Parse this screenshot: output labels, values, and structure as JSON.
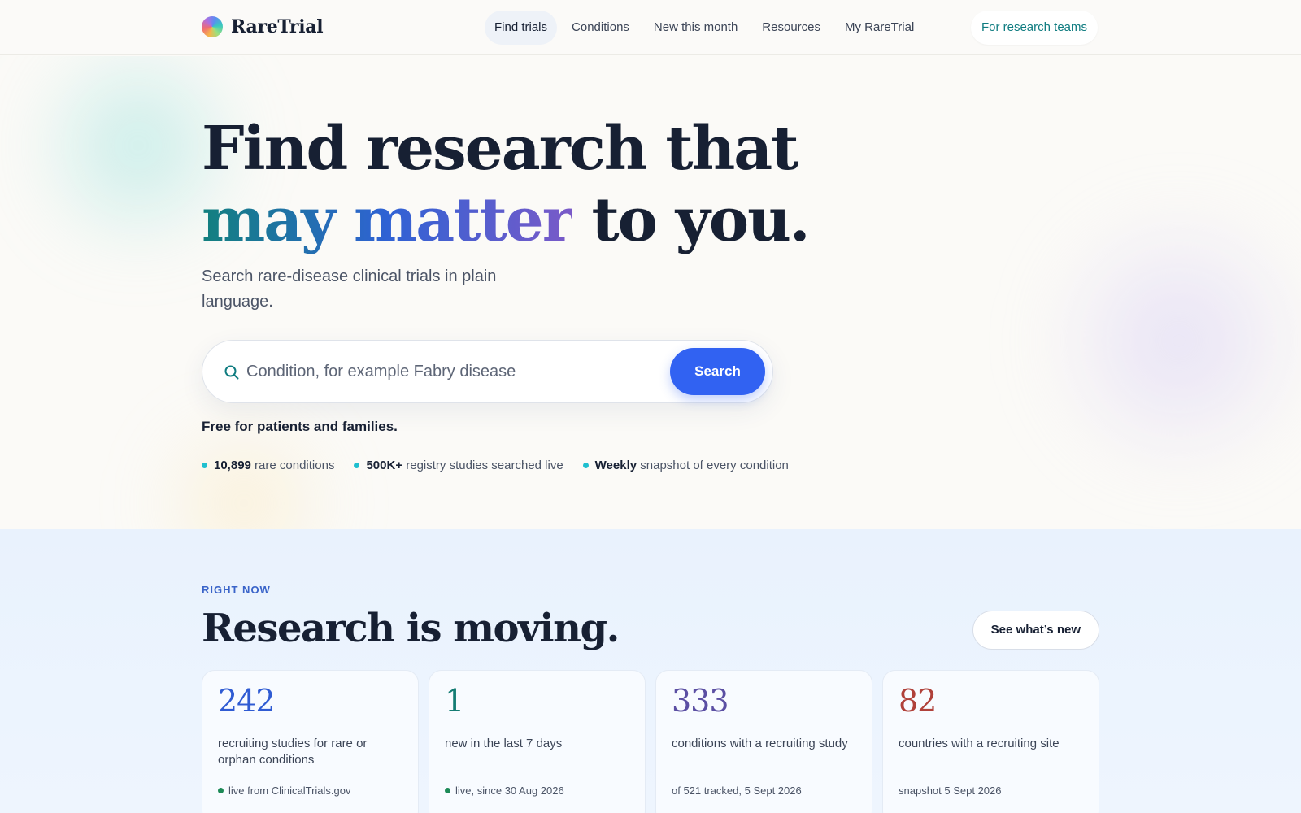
{
  "brand": {
    "name": "RareTrial",
    "logo_icon": "raretrial-logo-icon"
  },
  "nav": {
    "links": [
      {
        "label": "Find trials",
        "active": true
      },
      {
        "label": "Conditions",
        "active": false
      },
      {
        "label": "New this month",
        "active": false
      },
      {
        "label": "Resources",
        "active": false
      },
      {
        "label": "My RareTrial",
        "active": false
      }
    ],
    "cta_label": "For research teams"
  },
  "hero": {
    "headline_line1": "Find research that",
    "headline_highlight": "may matter",
    "headline_rest": " to you.",
    "subtitle": "Search rare-disease clinical trials in plain language.",
    "search": {
      "icon": "search-icon",
      "placeholder": "Condition, for example Fabry disease",
      "value": "",
      "button_label": "Search"
    },
    "free_note": "Free for patients and families.",
    "stats": [
      {
        "strong": "10,899",
        "text": " rare conditions"
      },
      {
        "strong": "500K+",
        "text": " registry studies searched live"
      },
      {
        "strong": "Weekly",
        "text": " snapshot of every condition"
      }
    ]
  },
  "right_now": {
    "eyebrow": "RIGHT NOW",
    "title": "Research is moving.",
    "button_label": "See what’s new",
    "cards": [
      {
        "number": "242",
        "color": "#2f5bd3",
        "description": "recruiting studies for rare or orphan conditions",
        "footnote": "live from ClinicalTrials.gov",
        "live": true
      },
      {
        "number": "1",
        "color": "#147c73",
        "description": "new in the last 7 days",
        "footnote": "live, since 30 Aug 2026",
        "live": true
      },
      {
        "number": "333",
        "color": "#5b4fa3",
        "description": "conditions with a recruiting study",
        "footnote": "of 521 tracked, 5 Sept 2026",
        "live": false
      },
      {
        "number": "82",
        "color": "#b0413a",
        "description": "countries with a recruiting site",
        "footnote": "snapshot 5 Sept 2026",
        "live": false
      }
    ]
  },
  "colors": {
    "accent": "#3162f2",
    "teal": "#0f7c80",
    "ink": "#172033",
    "live_dot": "#1d8a57",
    "stat_dot": "#1fbfcf"
  }
}
